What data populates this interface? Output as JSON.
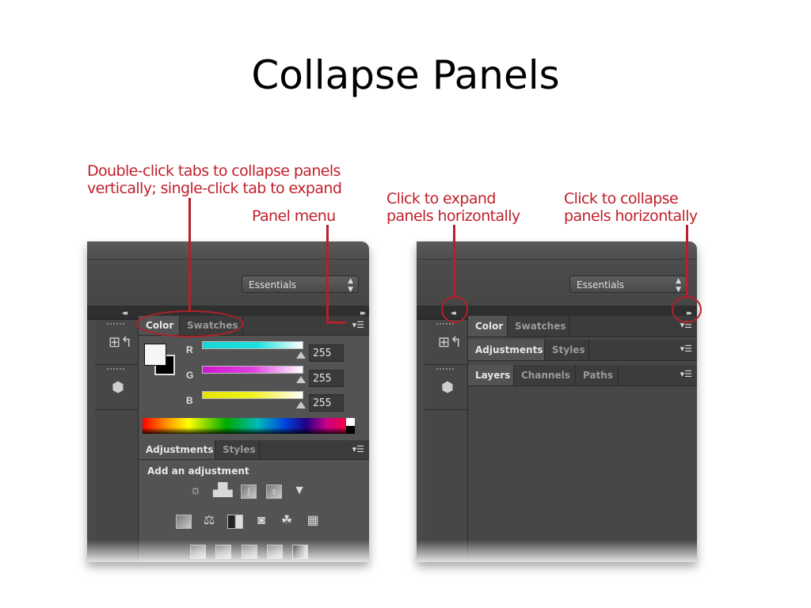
{
  "slide": {
    "title": "Collapse Panels"
  },
  "callouts": {
    "collapse_vertical": [
      "Double-click tabs to collapse panels",
      "vertically; single-click tab to expand"
    ],
    "panel_menu": "Panel menu",
    "expand_horizontal": [
      "Click to expand",
      "panels horizontally"
    ],
    "collapse_horizontal": [
      "Click to collapse",
      "panels horizontally"
    ]
  },
  "colors": {
    "callout_red": "#c0202a",
    "ui_dark": "#4a4a4a",
    "ui_panel": "#535353"
  },
  "left_screenshot": {
    "workspace_select": "Essentials",
    "collapse_left_icon": "◂◂",
    "collapse_right_icon": "▸▸",
    "color_panel": {
      "tabs": [
        "Color",
        "Swatches"
      ],
      "active_tab": "Color",
      "channels": [
        {
          "label": "R",
          "value": "255"
        },
        {
          "label": "G",
          "value": "255"
        },
        {
          "label": "B",
          "value": "255"
        }
      ]
    },
    "adjustments_panel": {
      "tabs": [
        "Adjustments",
        "Styles"
      ],
      "active_tab": "Adjustments",
      "heading": "Add an adjustment",
      "icon_rows": [
        [
          "brightness-contrast-icon",
          "levels-icon",
          "curves-icon",
          "exposure-icon",
          "vibrance-icon"
        ],
        [
          "hue-saturation-icon",
          "color-balance-icon",
          "black-white-icon",
          "photo-filter-icon",
          "channel-mixer-icon",
          "color-lookup-icon"
        ],
        [
          "invert-icon",
          "posterize-icon",
          "threshold-icon",
          "selective-color-icon",
          "gradient-map-icon"
        ]
      ]
    }
  },
  "right_screenshot": {
    "workspace_select": "Essentials",
    "collapse_left_icon": "◂◂",
    "collapse_right_icon": "▸▸",
    "panel_groups": [
      {
        "tabs": [
          "Color",
          "Swatches"
        ],
        "active_tab": "Color"
      },
      {
        "tabs": [
          "Adjustments",
          "Styles"
        ],
        "active_tab": "Adjustments"
      },
      {
        "tabs": [
          "Layers",
          "Channels",
          "Paths"
        ],
        "active_tab": "Layers"
      }
    ]
  }
}
